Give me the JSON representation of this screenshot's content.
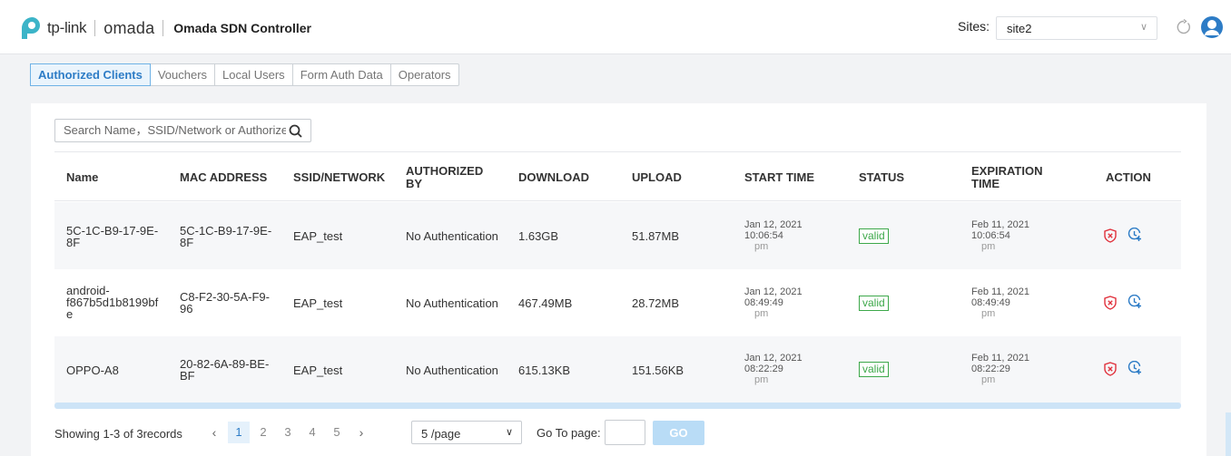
{
  "header": {
    "brand": "tp-link",
    "product": "omada",
    "title": "Omada SDN Controller",
    "sites_label": "Sites:",
    "site_value": "site2"
  },
  "tabs": [
    {
      "label": "Authorized Clients",
      "active": true
    },
    {
      "label": "Vouchers",
      "active": false
    },
    {
      "label": "Local Users",
      "active": false
    },
    {
      "label": "Form Auth Data",
      "active": false
    },
    {
      "label": "Operators",
      "active": false
    }
  ],
  "search": {
    "placeholder": "Search Name，SSID/Network or Authorized"
  },
  "table": {
    "columns": [
      "Name",
      "MAC ADDRESS",
      "SSID/NETWORK",
      "AUTHORIZED BY",
      "DOWNLOAD",
      "UPLOAD",
      "START TIME",
      "STATUS",
      "EXPIRATION TIME",
      "ACTION"
    ],
    "rows": [
      {
        "name": [
          "5C-1C-B9-17-9E-",
          "8F"
        ],
        "mac": [
          "5C-1C-B9-17-9E-",
          "8F"
        ],
        "ssid": "EAP_test",
        "auth": "No Authentication",
        "download": "1.63GB",
        "upload": "51.87MB",
        "start": [
          "Jan 12, 2021",
          "10:06:54",
          "pm"
        ],
        "status": "valid",
        "expire": [
          "Feb 11, 2021",
          "10:06:54",
          "pm"
        ]
      },
      {
        "name": [
          "android-",
          "f867b5d1b8199bf",
          "e"
        ],
        "mac": [
          "C8-F2-30-5A-F9-",
          "96"
        ],
        "ssid": "EAP_test",
        "auth": "No Authentication",
        "download": "467.49MB",
        "upload": "28.72MB",
        "start": [
          "Jan 12, 2021",
          "08:49:49",
          "pm"
        ],
        "status": "valid",
        "expire": [
          "Feb 11, 2021",
          "08:49:49",
          "pm"
        ]
      },
      {
        "name": [
          "OPPO-A8"
        ],
        "mac": [
          "20-82-6A-89-BE-",
          "BF"
        ],
        "ssid": "EAP_test",
        "auth": "No Authentication",
        "download": "615.13KB",
        "upload": "151.56KB",
        "start": [
          "Jan 12, 2021",
          "08:22:29",
          "pm"
        ],
        "status": "valid",
        "expire": [
          "Feb 11, 2021",
          "08:22:29",
          "pm"
        ]
      }
    ]
  },
  "footer": {
    "records": "Showing 1-3 of 3records",
    "pages": [
      "1",
      "2",
      "3",
      "4",
      "5"
    ],
    "current_page": "1",
    "per_page": "5 /page",
    "goto_label": "Go To page:",
    "go_label": "GO"
  },
  "colors": {
    "accent": "#2d7cc6",
    "valid": "#3da84a",
    "danger": "#e0313c"
  }
}
